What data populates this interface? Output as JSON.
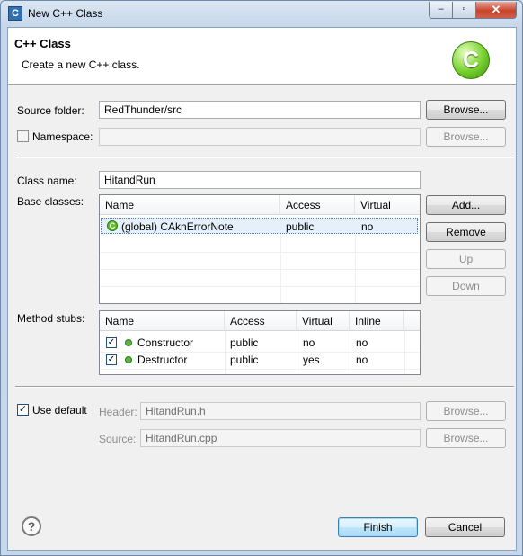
{
  "window": {
    "title": "New C++ Class",
    "controls": {
      "minimize": "–",
      "maximize": "▫",
      "close": "✕"
    }
  },
  "header": {
    "title": "C++ Class",
    "description": "Create a new C++ class.",
    "logo_letter": "C"
  },
  "source_folder": {
    "label": "Source folder:",
    "value": "RedThunder/src",
    "browse_label": "Browse..."
  },
  "namespace": {
    "label": "Namespace:",
    "checked": false,
    "value": "",
    "browse_label": "Browse..."
  },
  "class_name": {
    "label": "Class name:",
    "value": "HitandRun"
  },
  "base_classes": {
    "label": "Base classes:",
    "columns": [
      "Name",
      "Access",
      "Virtual"
    ],
    "rows": [
      {
        "name": "(global) CAknErrorNote",
        "access": "public",
        "virtual": "no",
        "selected": true
      }
    ],
    "buttons": {
      "add": "Add...",
      "remove": "Remove",
      "up": "Up",
      "down": "Down"
    }
  },
  "method_stubs": {
    "label": "Method stubs:",
    "columns": [
      "Name",
      "Access",
      "Virtual",
      "Inline"
    ],
    "rows": [
      {
        "checked": true,
        "name": "Constructor",
        "access": "public",
        "virtual": "no",
        "inline": "no"
      },
      {
        "checked": true,
        "name": "Destructor",
        "access": "public",
        "virtual": "yes",
        "inline": "no"
      }
    ]
  },
  "file_names": {
    "use_default_label": "Use default",
    "use_default_checked": true,
    "header_label": "Header:",
    "header_value": "HitandRun.h",
    "source_label": "Source:",
    "source_value": "HitandRun.cpp",
    "browse_label": "Browse..."
  },
  "footer": {
    "help": "?",
    "finish": "Finish",
    "cancel": "Cancel"
  },
  "colors": {
    "accent": "#3c7fb1",
    "logo_green": "#75cf2b",
    "selection": "#e5f0fb"
  }
}
